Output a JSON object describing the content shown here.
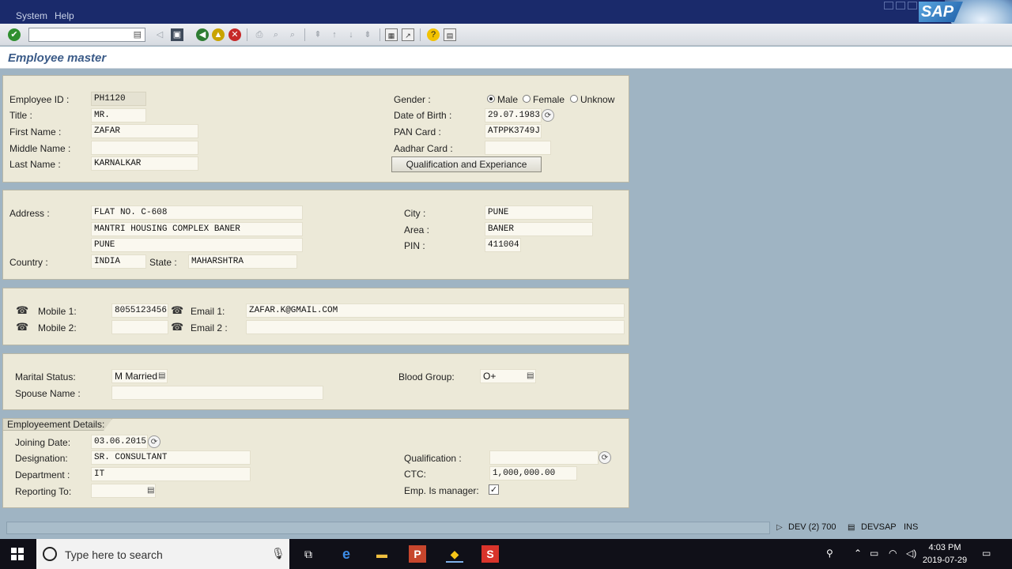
{
  "menubar": {
    "system": "System",
    "help": "Help",
    "logo": "SAP"
  },
  "toolbar": {
    "command_value": ""
  },
  "title": "Employee master",
  "personal": {
    "employee_id_label": "Employee ID :",
    "employee_id": "PH1120",
    "title_label": "Title :",
    "title": "MR.",
    "first_name_label": "First Name :",
    "first_name": "ZAFAR",
    "middle_name_label": "Middle Name :",
    "middle_name": "",
    "last_name_label": "Last Name :",
    "last_name": "KARNALKAR",
    "gender_label": "Gender :",
    "gender_options": [
      "Male",
      "Female",
      "Unknow"
    ],
    "gender_selected": "Male",
    "dob_label": "Date of Birth :",
    "dob": "29.07.1983",
    "pan_label": "PAN Card :",
    "pan": "ATPPK3749J",
    "aadhar_label": "Aadhar Card :",
    "aadhar": "",
    "qualification_button": "Qualification and Experiance"
  },
  "address": {
    "address_label": "Address :",
    "line1": "FLAT NO. C-608",
    "line2": "MANTRI HOUSING COMPLEX BANER",
    "line3": "PUNE",
    "country_label": "Country :",
    "country": "INDIA",
    "state_label": "State :",
    "state": "MAHARSHTRA",
    "city_label": "City :",
    "city": "PUNE",
    "area_label": "Area :",
    "area": "BANER",
    "pin_label": "PIN :",
    "pin": "411004"
  },
  "contact": {
    "mobile1_label": "Mobile 1:",
    "mobile1": "8055123456",
    "mobile2_label": "Mobile 2:",
    "mobile2": "",
    "email1_label": "Email 1:",
    "email1": "ZAFAR.K@GMAIL.COM",
    "email2_label": "Email 2 :",
    "email2": ""
  },
  "family": {
    "marital_label": "Marital Status:",
    "marital": "M Married",
    "spouse_label": "Spouse Name :",
    "spouse": "",
    "blood_label": "Blood Group:",
    "blood": "O+"
  },
  "employment": {
    "header": "Employeement Details:",
    "joining_label": "Joining Date:",
    "joining": "03.06.2015",
    "designation_label": "Designation:",
    "designation": "SR. CONSULTANT",
    "department_label": "Department :",
    "department": "IT",
    "reporting_label": "Reporting To:",
    "reporting": "",
    "qualification_label": "Qualification :",
    "qualification": "",
    "ctc_label": "CTC:",
    "ctc": "1,000,000.00",
    "manager_label": "Emp. Is manager:",
    "manager_checked": true
  },
  "status": {
    "system": "DEV (2) 700",
    "server": "DEVSAP",
    "mode": "INS"
  },
  "taskbar": {
    "search_placeholder": "Type here to search",
    "time": "4:03 PM",
    "date": "2019-07-29"
  }
}
